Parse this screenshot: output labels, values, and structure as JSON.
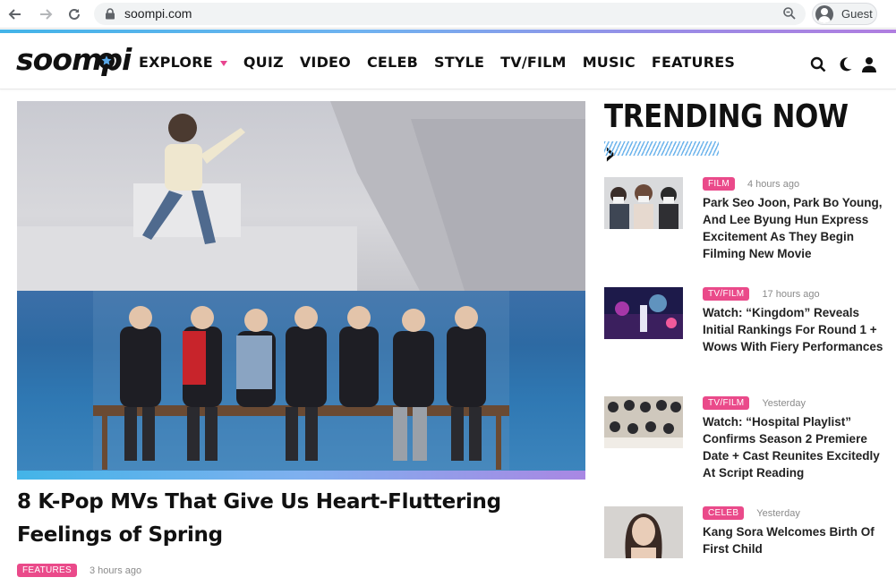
{
  "browser": {
    "url": "soompi.com",
    "profile_label": "Guest"
  },
  "site": {
    "logo_text": "soompi",
    "menu": [
      "EXPLORE",
      "QUIZ",
      "VIDEO",
      "CELEB",
      "STYLE",
      "TV/FILM",
      "MUSIC",
      "FEATURES"
    ],
    "accent_color": "#ea4a8a"
  },
  "hero": {
    "title": "8 K-Pop MVs That Give Us Heart-Fluttering Feelings of Spring",
    "badge": "FEATURES",
    "time": "3 hours ago"
  },
  "trending": {
    "title": "TRENDING NOW",
    "arrow": "›",
    "items": [
      {
        "badge": "FILM",
        "time": "4 hours ago",
        "headline": "Park Seo Joon, Park Bo Young, And Lee Byung Hun Express Excitement As They Begin Filming New Movie"
      },
      {
        "badge": "TV/FILM",
        "time": "17 hours ago",
        "headline": "Watch: “Kingdom” Reveals Initial Rankings For Round 1 + Wows With Fiery Performances"
      },
      {
        "badge": "TV/FILM",
        "time": "Yesterday",
        "headline": "Watch: “Hospital Playlist” Confirms Season 2 Premiere Date + Cast Reunites Excitedly At Script Reading"
      },
      {
        "badge": "CELEB",
        "time": "Yesterday",
        "headline": "Kang Sora Welcomes Birth Of First Child"
      }
    ]
  }
}
